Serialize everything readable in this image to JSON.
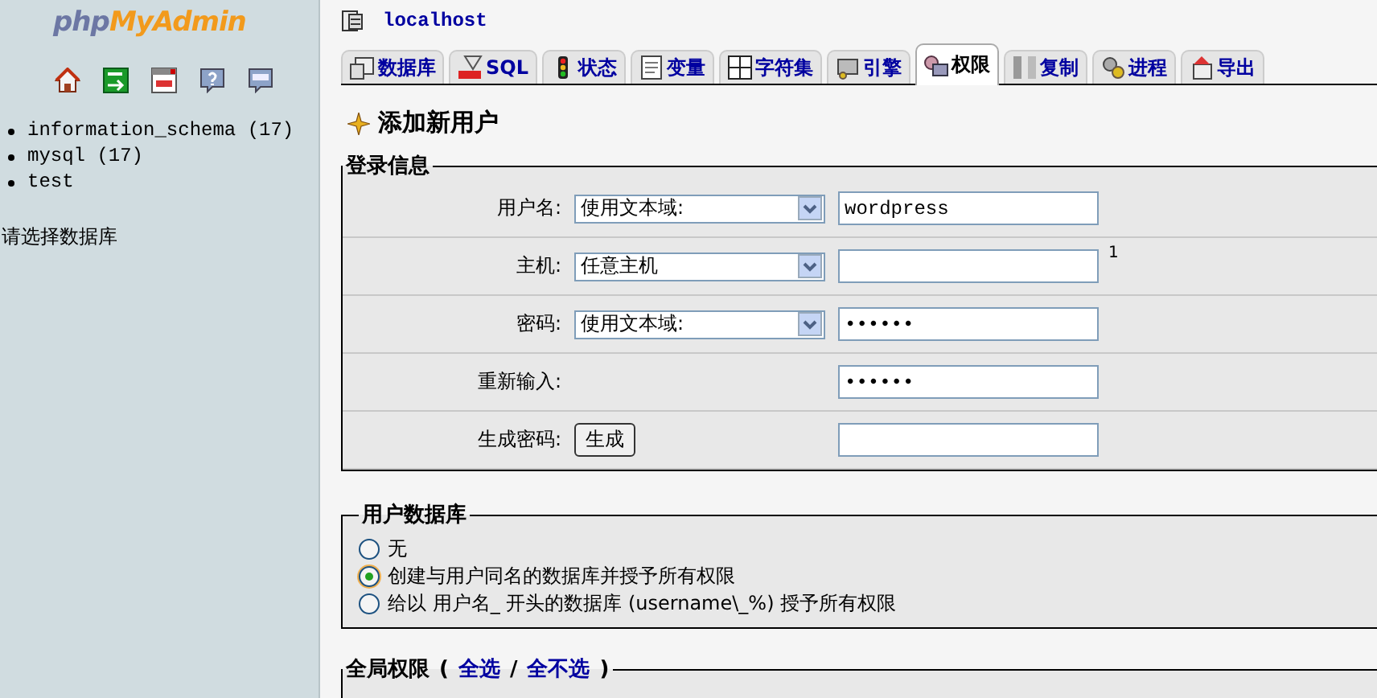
{
  "sidebar": {
    "logo": {
      "part_1": "php",
      "part_2": "MyAdmin"
    },
    "databases": [
      {
        "label": "information_schema (17)"
      },
      {
        "label": "mysql (17)"
      },
      {
        "label": "test"
      }
    ],
    "hint": "请选择数据库"
  },
  "server": {
    "title": "localhost"
  },
  "tabs": [
    {
      "label": "数据库",
      "selected": false
    },
    {
      "label": "SQL",
      "selected": false
    },
    {
      "label": "状态",
      "selected": false
    },
    {
      "label": "变量",
      "selected": false
    },
    {
      "label": "字符集",
      "selected": false
    },
    {
      "label": "引擎",
      "selected": false
    },
    {
      "label": "权限",
      "selected": true
    },
    {
      "label": "复制",
      "selected": false
    },
    {
      "label": "进程",
      "selected": false
    },
    {
      "label": "导出",
      "selected": false
    }
  ],
  "page_title": "添加新用户",
  "login_info": {
    "legend": "登录信息",
    "rows": [
      {
        "label": "用户名:",
        "kind": "select",
        "select": "使用文本域:",
        "value": "wordpress"
      },
      {
        "label": "主机:",
        "kind": "select",
        "select": "任意主机",
        "value": "",
        "note": "1"
      },
      {
        "label": "密码:",
        "kind": "select",
        "select": "使用文本域:",
        "value": "••••••"
      },
      {
        "label": "重新输入:",
        "kind": "plain",
        "value": "••••••"
      },
      {
        "label": "生成密码:",
        "kind": "button",
        "button": "生成",
        "value": ""
      }
    ]
  },
  "user_database": {
    "legend": "用户数据库",
    "options": [
      {
        "label": "无",
        "selected": false
      },
      {
        "label": "创建与用户同名的数据库并授予所有权限",
        "selected": true
      },
      {
        "label": "给以 用户名_ 开头的数据库 (username\\_%) 授予所有权限",
        "selected": false
      }
    ]
  },
  "global_privileges": {
    "legend": "全局权限",
    "open": "(",
    "select_all": "全选",
    "separator": "/",
    "deselect_all": "全不选",
    "close": ")"
  }
}
